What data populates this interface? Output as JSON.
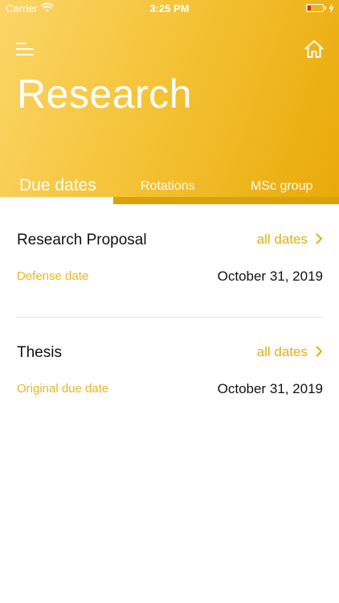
{
  "status_bar": {
    "carrier": "Carrier",
    "time": "3:25 PM",
    "battery_color": "#e02a1f"
  },
  "header": {
    "title": "Research",
    "menu_icon": "hamburger-menu-icon",
    "home_icon": "home-icon",
    "gradient": [
      "#fbd567",
      "#e9a909"
    ]
  },
  "tabs": [
    {
      "label": "Due dates",
      "active": true
    },
    {
      "label": "Rotations",
      "active": false
    },
    {
      "label": "MSc group",
      "active": false
    }
  ],
  "sections": [
    {
      "title": "Research Proposal",
      "link_label": "all dates",
      "rows": [
        {
          "label": "Defense date",
          "value": "October 31, 2019"
        }
      ]
    },
    {
      "title": "Thesis",
      "link_label": "all dates",
      "rows": [
        {
          "label": "Original due date",
          "value": "October 31, 2019"
        }
      ]
    }
  ],
  "colors": {
    "accent": "#e8ad10",
    "label": "#e8b52a",
    "text": "#111111"
  }
}
